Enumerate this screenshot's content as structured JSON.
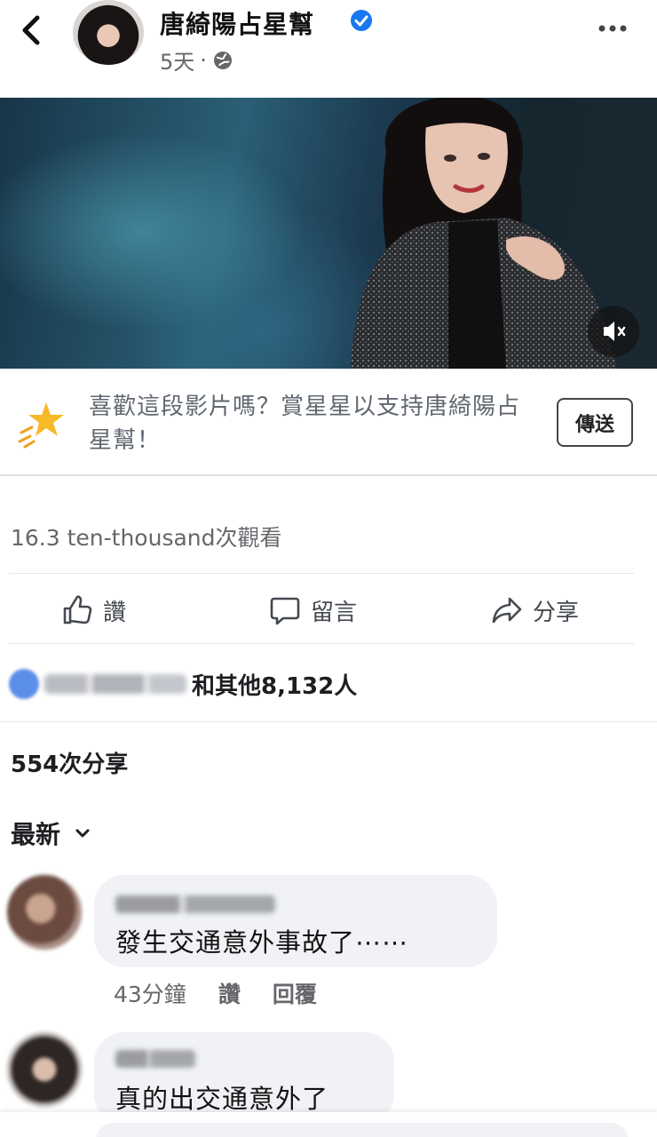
{
  "header": {
    "page_name": "唐綺陽占星幫",
    "time": "5天",
    "separator": "·"
  },
  "stars_promo": {
    "text": "喜歡這段影片嗎？賞星星以支持唐綺陽占星幫！",
    "button": "傳送"
  },
  "views": "16.3 ten-thousand次觀看",
  "actions": {
    "like": "讚",
    "comment": "留言",
    "share": "分享"
  },
  "reactions": {
    "others": "和其他8,132人"
  },
  "shares": "554次分享",
  "sort": {
    "label": "最新"
  },
  "comments": [
    {
      "text": "發生交通意外事故了⋯⋯",
      "time": "43分鐘",
      "like": "讚",
      "reply": "回覆"
    },
    {
      "text": "真的出交通意外了"
    }
  ],
  "colors": {
    "verified": "#1877f2",
    "secondary_text": "#65676b",
    "bubble": "#f0f2f5"
  },
  "icons": [
    "back-icon",
    "verified-icon",
    "globe-icon",
    "more-icon",
    "mute-icon",
    "star-icon",
    "like-icon",
    "comment-icon",
    "share-icon",
    "chevron-down-icon"
  ]
}
